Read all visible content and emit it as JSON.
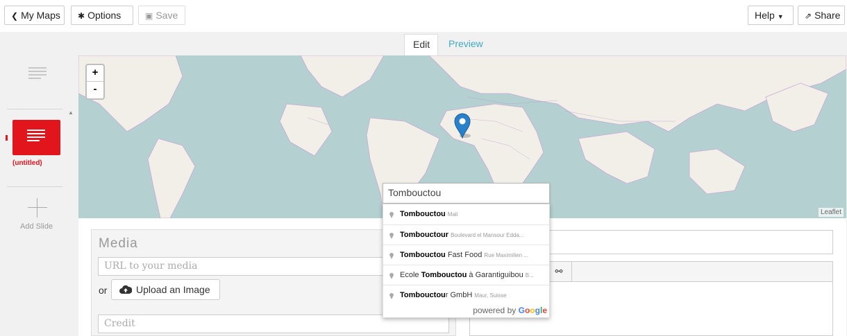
{
  "toolbar": {
    "my_maps_label": "My Maps",
    "options_label": "Options",
    "save_label": "Save",
    "help_label": "Help",
    "share_label": "Share"
  },
  "tabs": {
    "edit": "Edit",
    "preview": "Preview"
  },
  "sidebar": {
    "slide_title": "(untitled)",
    "add_slide_label": "Add Slide"
  },
  "map": {
    "zoom_in": "+",
    "zoom_out": "-",
    "attribution": "Leaflet",
    "search_value": "Tombouctou",
    "suggestions": [
      {
        "bold": "Tombouctou",
        "rest": "",
        "secondary": "Mali"
      },
      {
        "bold": "Tombouctour",
        "rest": "",
        "secondary": "Boulevard el Mansour Edda..."
      },
      {
        "bold": "Tombouctou",
        "rest": " Fast Food",
        "secondary": "Rue Maximilien ..."
      },
      {
        "pre": "Ecole ",
        "bold": "Tombouctou",
        "rest": " à Garantiguibou",
        "secondary": "B..."
      },
      {
        "bold": "Tombouctou",
        "rest": "r GmbH",
        "secondary": "Maur, Suisse"
      }
    ],
    "powered_by": "powered by",
    "google": [
      "G",
      "o",
      "o",
      "g",
      "l",
      "e"
    ]
  },
  "media": {
    "title": "Media",
    "url_placeholder": "URL to your media",
    "or_label": "or",
    "upload_label": "Upload an Image",
    "credit_placeholder": "Credit"
  },
  "colors": {
    "accent": "#e2141c",
    "link": "#3fa9c9",
    "water": "#b5d0d0",
    "land": "#f2efe9",
    "pin": "#2a81cb"
  }
}
